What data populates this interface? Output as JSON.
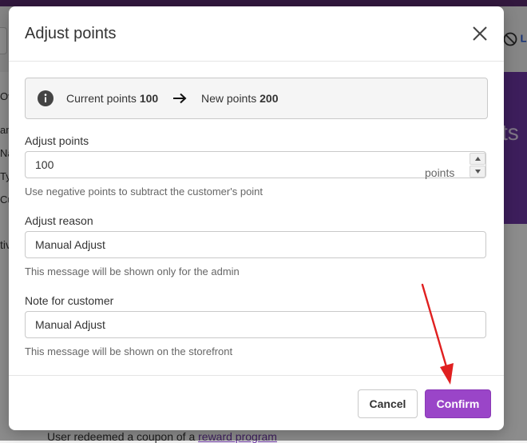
{
  "background": {
    "left_fragments": [
      "Ov",
      "am",
      "Na",
      "Typ",
      "Cu",
      "tiv"
    ],
    "top_right_label": "L",
    "purple_panel": {
      "fragment_1": "s",
      "fragment_2": "ts"
    },
    "bottom_text": "User redeemed a coupon of a",
    "bottom_link": "reward program"
  },
  "modal": {
    "title": "Adjust points",
    "close_icon": "close-icon",
    "summary": {
      "current_label": "Current points",
      "current_value": "100",
      "new_label": "New points",
      "new_value": "200"
    },
    "adjust_points": {
      "label": "Adjust points",
      "value": "100",
      "suffix": "points",
      "help": "Use negative points to subtract the customer's point"
    },
    "adjust_reason": {
      "label": "Adjust reason",
      "value": "Manual Adjust",
      "help": "This message will be shown only for the admin"
    },
    "customer_note": {
      "label": "Note for customer",
      "value": "Manual Adjust",
      "help": "This message will be shown on the storefront"
    },
    "footer": {
      "cancel_label": "Cancel",
      "confirm_label": "Confirm"
    }
  },
  "colors": {
    "accent": "#9a45c8",
    "annotation": "#e02020",
    "brand_dark": "#5c2c72"
  }
}
